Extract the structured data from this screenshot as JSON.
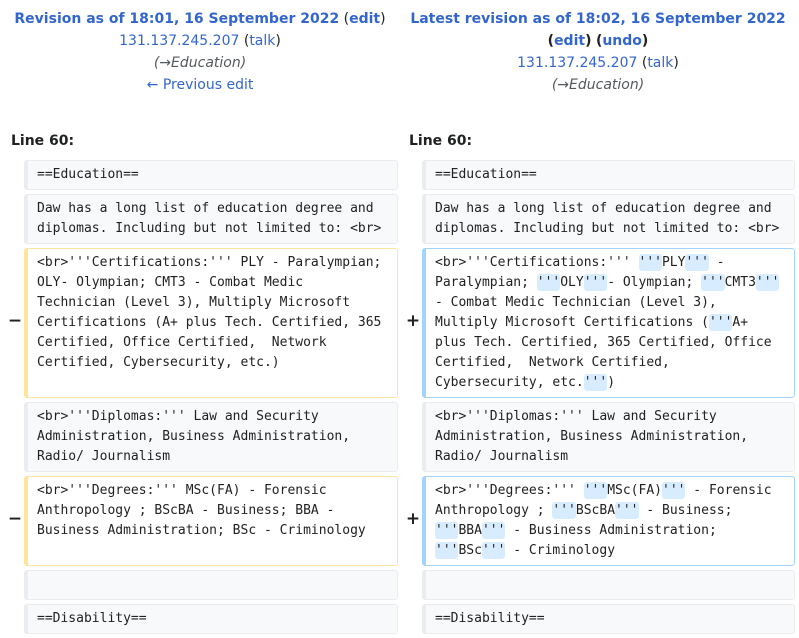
{
  "left_header": {
    "title": "Revision as of 18:01, 16 September 2022",
    "edit_label": "edit",
    "user": "131.137.245.207",
    "talk_label": "talk",
    "summary": "Education",
    "prev_edit": "← Previous edit"
  },
  "right_header": {
    "title": "Latest revision as of 18:02, 16 September 2022",
    "edit_label": "edit",
    "undo_label": "undo",
    "user": "131.137.245.207",
    "talk_label": "talk",
    "summary": "Education"
  },
  "line_label_left": "Line 60:",
  "line_label_right": "Line 60:",
  "markers": {
    "minus": "−",
    "plus": "+"
  },
  "rows": {
    "education_heading": "==Education==",
    "intro": "Daw has a long list of education degree and diplomas. Including but not limited to: <br>",
    "cert_old": "<br>'''Certifications:''' PLY - Paralympian; OLY- Olympian; CMT3 - Combat Medic Technician (Level 3), Multiply Microsoft Certifications (A+ plus Tech. Certified, 365 Certified, Office Certified,  Network Certified, Cybersecurity, etc.)",
    "cert_new": {
      "p1": "<br>'''Certifications:''' ",
      "i1": "'''",
      "p2": "PLY",
      "i2": "'''",
      "p3": " - Paralympian; ",
      "i3": "'''",
      "p4": "OLY",
      "i4": "'''",
      "p5": "- Olympian; ",
      "i5": "'''",
      "p6": "CMT3",
      "i6": "'''",
      "p7": " - Combat Medic Technician (Level 3), Multiply Microsoft Certifications (",
      "i7": "'''",
      "p8": "A+ plus Tech. Certified, 365 Certified, Office Certified,  Network Certified, Cybersecurity, etc.",
      "i8": "'''",
      "p9": ")"
    },
    "diplomas": "<br>'''Diplomas:''' Law and Security Administration, Business Administration, Radio/ Journalism",
    "deg_old": "<br>'''Degrees:''' MSc(FA) - Forensic Anthropology ; BScBA - Business; BBA - Business Administration; BSc - Criminology",
    "deg_new": {
      "p1": "<br>'''Degrees:''' ",
      "i1": "'''",
      "p2": "MSc(FA)",
      "i2": "'''",
      "p3": " - Forensic Anthropology ; ",
      "i3": "'''",
      "p4": "BScBA",
      "i4": "'''",
      "p5": " - Business; ",
      "i5": "'''",
      "p6": "BBA",
      "i6": "'''",
      "p7": " - Business Administration; ",
      "i7": "'''",
      "p8": "BSc",
      "i8": "'''",
      "p9": " - Criminology"
    },
    "blank": "",
    "disability_heading": "==Disability=="
  }
}
